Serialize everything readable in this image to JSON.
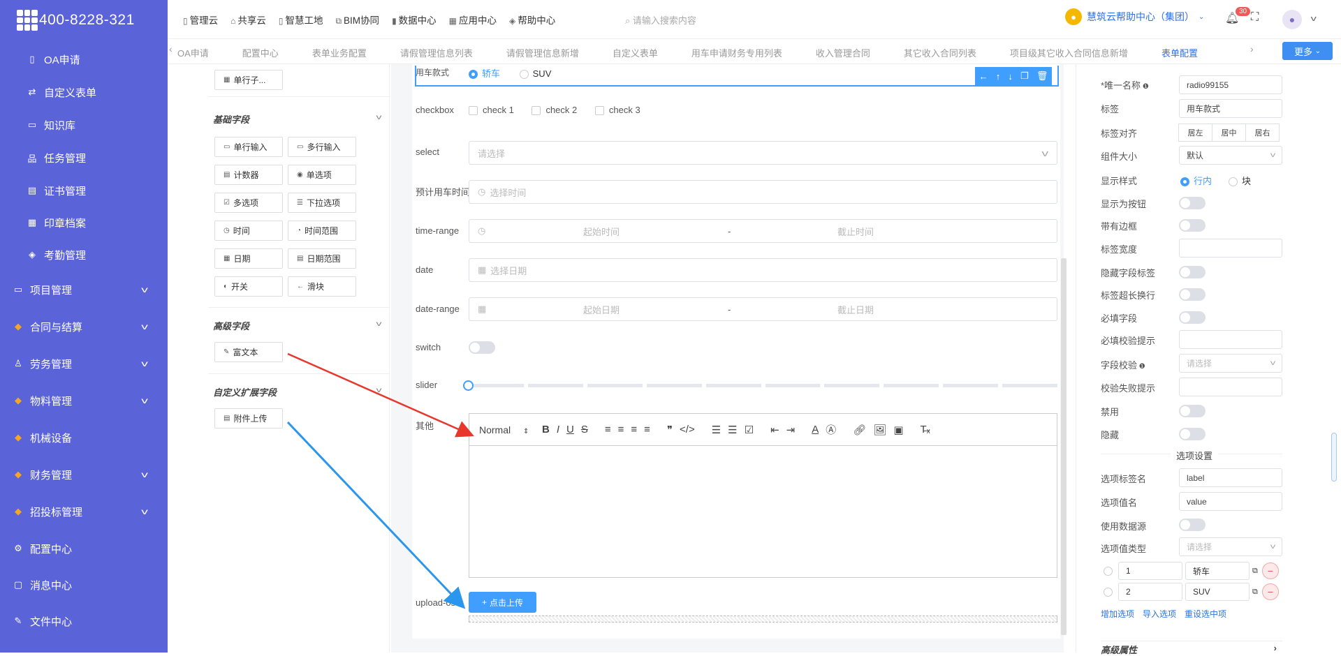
{
  "brand": {
    "phone": "400-8228-321"
  },
  "sidebar": {
    "items": [
      {
        "label": "OA申请",
        "icon": "document-icon"
      },
      {
        "label": "自定义表单",
        "icon": "swap-icon"
      },
      {
        "label": "知识库",
        "icon": "book-icon"
      },
      {
        "label": "任务管理",
        "icon": "hierarchy-icon"
      },
      {
        "label": "证书管理",
        "icon": "certificate-icon"
      },
      {
        "label": "印章档案",
        "icon": "grid-icon"
      },
      {
        "label": "考勤管理",
        "icon": "tag-icon"
      },
      {
        "label": "项目管理",
        "icon": "book-icon"
      },
      {
        "label": "合同与结算",
        "icon": "diamond-icon"
      },
      {
        "label": "劳务管理",
        "icon": "user-icon"
      },
      {
        "label": "物料管理",
        "icon": "diamond-icon"
      },
      {
        "label": "机械设备",
        "icon": "diamond-icon"
      },
      {
        "label": "财务管理",
        "icon": "diamond-icon"
      },
      {
        "label": "招投标管理",
        "icon": "diamond-icon"
      },
      {
        "label": "配置中心",
        "icon": "gear-icon"
      },
      {
        "label": "消息中心",
        "icon": "chat-icon"
      },
      {
        "label": "文件中心",
        "icon": "edit-icon"
      }
    ]
  },
  "topnav": {
    "items": [
      "管理云",
      "共享云",
      "智慧工地",
      "BIM协同",
      "数据中心",
      "应用中心",
      "帮助中心"
    ],
    "search_placeholder": "请输入搜索内容",
    "help_center": "慧筑云帮助中心（集团）",
    "notif_count": "30"
  },
  "tabs": {
    "items": [
      "OA申请",
      "配置中心",
      "表单业务配置",
      "请假管理信息列表",
      "请假管理信息新增",
      "自定义表单",
      "用车申请财务专用列表",
      "收入管理合同",
      "其它收入合同列表",
      "项目级其它收入合同信息新增",
      "表单配置"
    ],
    "more": "更多",
    "left_arrow": "‹",
    "right_arrow": "›"
  },
  "leftpanel": {
    "single_row_partial": "单行子...",
    "basic_title": "基础字段",
    "basic": [
      "单行输入",
      "多行输入",
      "计数器",
      "单选项",
      "多选项",
      "下拉选项",
      "时间",
      "时间范围",
      "日期",
      "日期范围",
      "开关",
      "滑块"
    ],
    "advanced_title": "高级字段",
    "advanced": [
      "富文本"
    ],
    "custom_title": "自定义扩展字段",
    "custom": [
      "附件上传"
    ]
  },
  "form": {
    "radio_label": "用车款式",
    "radio_opts": [
      "轿车",
      "SUV"
    ],
    "checkbox_label": "checkbox",
    "checkbox_opts": [
      "check 1",
      "check 2",
      "check 3"
    ],
    "select_label": "select",
    "select_ph": "请选择",
    "time_label": "预计用车时间",
    "time_ph": "选择时间",
    "trange_label": "time-range",
    "trange_start": "起始时间",
    "trange_end": "截止时间",
    "range_sep": "-",
    "date_label": "date",
    "date_ph": "选择日期",
    "drange_label": "date-range",
    "drange_start": "起始日期",
    "drange_end": "截止日期",
    "switch_label": "switch",
    "slider_label": "slider",
    "slider_value": 0,
    "rich_label": "其他",
    "rich_format": "Normal",
    "upload_label": "upload-oss",
    "upload_btn": "点击上传"
  },
  "props": {
    "unique_label": "唯一名称",
    "unique_value": "radio99155",
    "tag_label": "标签",
    "tag_value": "用车款式",
    "align_label": "标签对齐",
    "align_opts": [
      "居左",
      "居中",
      "居右"
    ],
    "size_label": "组件大小",
    "size_value": "默认",
    "style_label": "显示样式",
    "style_opts": [
      "行内",
      "块"
    ],
    "as_button": "显示为按钮",
    "border": "带有边框",
    "label_width": "标签宽度",
    "hide_label": "隐藏字段标签",
    "wrap": "标签超长换行",
    "required": "必填字段",
    "required_tip": "必填校验提示",
    "validate": "字段校验",
    "validate_ph": "请选择",
    "validate_fail": "校验失败提示",
    "disabled": "禁用",
    "hidden": "隐藏",
    "options_title": "选项设置",
    "opt_label_name": "选项标签名",
    "opt_label_value": "label",
    "opt_value_name": "选项值名",
    "opt_value_value": "value",
    "use_ds": "使用数据源",
    "opt_type": "选项值类型",
    "opt_type_ph": "请选择",
    "options": [
      {
        "value": "1",
        "label": "轿车"
      },
      {
        "value": "2",
        "label": "SUV"
      }
    ],
    "add_opt": "增加选项",
    "import_opt": "导入选项",
    "reset_opt": "重设选中项",
    "advanced": "高级属性"
  },
  "colors": {
    "sidebar": "#5a63d8",
    "accent": "#409eff",
    "red_arrow": "#e8382d",
    "blue_arrow": "#2a96ee"
  }
}
